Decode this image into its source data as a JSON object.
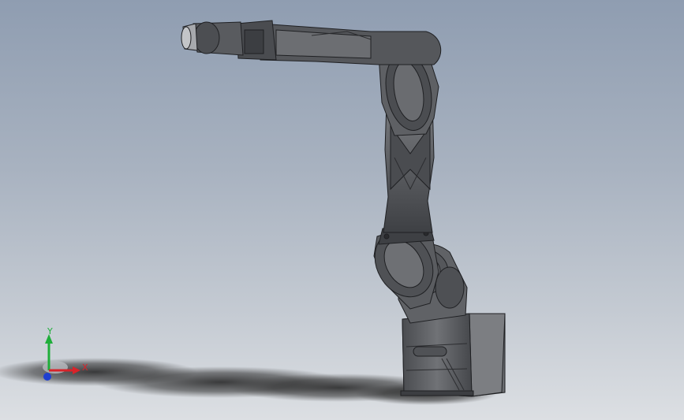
{
  "triad": {
    "x_label": "X",
    "y_label": "Y"
  },
  "colors": {
    "x_axis": "#d8232a",
    "y_axis": "#1fae3a",
    "z_axis": "#1f3fd0",
    "robot_body": "#5b5d61",
    "robot_dark": "#3a3c40",
    "robot_light": "#8a8c90",
    "shadow": "#2a2a2a"
  }
}
